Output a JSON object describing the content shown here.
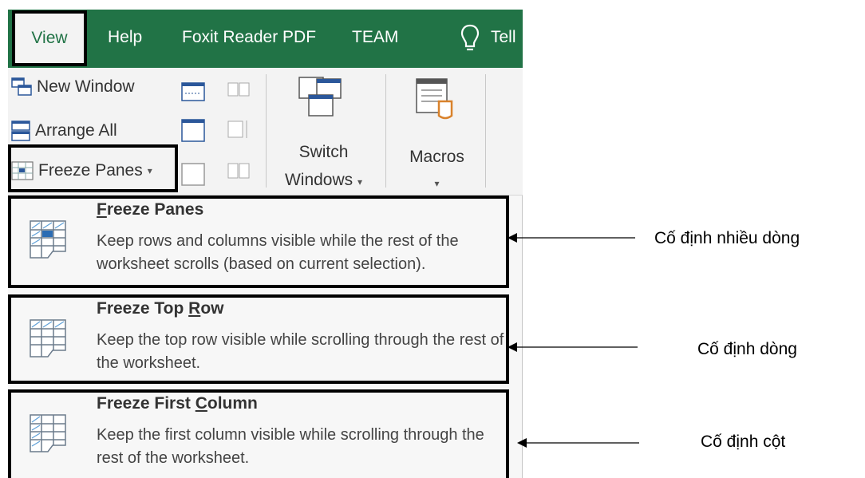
{
  "tabs": [
    {
      "label": "View",
      "selected": true
    },
    {
      "label": "Help"
    },
    {
      "label": "Foxit Reader PDF"
    },
    {
      "label": "TEAM"
    },
    {
      "label": "Tell"
    }
  ],
  "ribbon": {
    "new_window": "New Window",
    "arrange_all": "Arrange All",
    "freeze_panes": "Freeze Panes",
    "switch_windows_line1": "Switch",
    "switch_windows_line2": "Windows",
    "macros": "Macros"
  },
  "menu": {
    "items": [
      {
        "title_pre": "",
        "title_key": "F",
        "title_post": "reeze Panes",
        "desc": "Keep rows and columns visible while the rest of the worksheet scrolls (based on current selection)."
      },
      {
        "title_pre": "Freeze Top ",
        "title_key": "R",
        "title_post": "ow",
        "desc": "Keep the top row visible while scrolling through the rest of the worksheet."
      },
      {
        "title_pre": "Freeze First ",
        "title_key": "C",
        "title_post": "olumn",
        "desc": "Keep the first column visible while scrolling through the rest of the worksheet."
      }
    ]
  },
  "annotations": [
    {
      "text": "Cố định nhiều dòng"
    },
    {
      "text": "Cố định dòng"
    },
    {
      "text": "Cố định cột"
    }
  ],
  "colors": {
    "excel_green": "#217346",
    "ribbon_bg": "#f3f3f3",
    "highlight_box": "#000000"
  }
}
